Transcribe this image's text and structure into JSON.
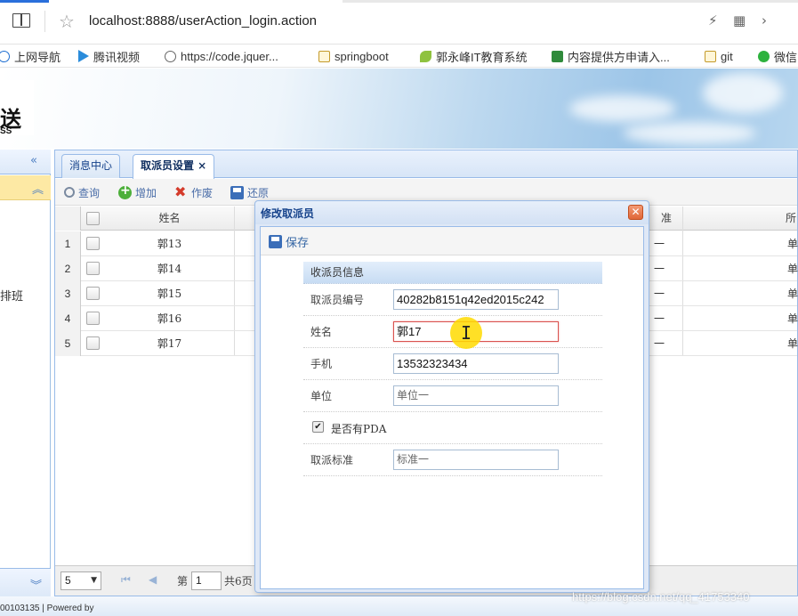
{
  "browser": {
    "url": "localhost:8888/userAction_login.action",
    "bookmarks": [
      {
        "label": "上网导航",
        "icon": "ie-icon"
      },
      {
        "label": "腾讯视频",
        "icon": "play-icon"
      },
      {
        "label": "https://code.jquer...",
        "icon": "globe-icon"
      },
      {
        "label": "springboot",
        "icon": "folder-icon"
      },
      {
        "label": "郭永峰IT教育系统",
        "icon": "leaf-icon"
      },
      {
        "label": "内容提供方申请入...",
        "icon": "book-icon"
      },
      {
        "label": "git",
        "icon": "folder-icon"
      },
      {
        "label": "微信",
        "icon": "chat-icon"
      }
    ]
  },
  "header": {
    "logo_text": "送",
    "logo_sub": "SS"
  },
  "left_panel": {
    "item_label": "排班"
  },
  "tabs": [
    {
      "label": "消息中心",
      "active": false
    },
    {
      "label": "取派员设置 ×",
      "active": true
    }
  ],
  "grid_toolbar": {
    "query": "查询",
    "add": "增加",
    "delete": "作废",
    "restore": "还原"
  },
  "grid": {
    "col_name": "姓名",
    "col_standard": "准",
    "col_unit": "所",
    "rows": [
      {
        "num": "1",
        "name": "郭13",
        "tail1": "一",
        "tail2": "单"
      },
      {
        "num": "2",
        "name": "郭14",
        "tail1": "一",
        "tail2": "单"
      },
      {
        "num": "3",
        "name": "郭15",
        "tail1": "一",
        "tail2": "单"
      },
      {
        "num": "4",
        "name": "郭16",
        "tail1": "一",
        "tail2": "单"
      },
      {
        "num": "5",
        "name": "郭17",
        "tail1": "一",
        "tail2": "单"
      }
    ]
  },
  "pager": {
    "page_size": "5",
    "page_prefix": "第",
    "page_number": "1",
    "total": "共6页"
  },
  "modal": {
    "title": "修改取派员",
    "save": "保存",
    "section_title": "收派员信息",
    "fields": {
      "id_label": "取派员编号",
      "id_value": "40282b8151q42ed2015c242",
      "name_label": "姓名",
      "name_value": "郭17",
      "phone_label": "手机",
      "phone_value": "13532323434",
      "unit_label": "单位",
      "unit_value": "单位一",
      "pda_label": "是否有PDA",
      "pda_checked": true,
      "standard_label": "取派标准",
      "standard_value": "标准一"
    }
  },
  "status": {
    "footer_text": "00103135 | Powered by"
  },
  "watermark": "https://blog.csdn.net/qq_41753340",
  "colors": {
    "accent": "#15428b",
    "border": "#99bbe8",
    "highlight": "#fde9a4",
    "error_border": "#d9534f"
  }
}
